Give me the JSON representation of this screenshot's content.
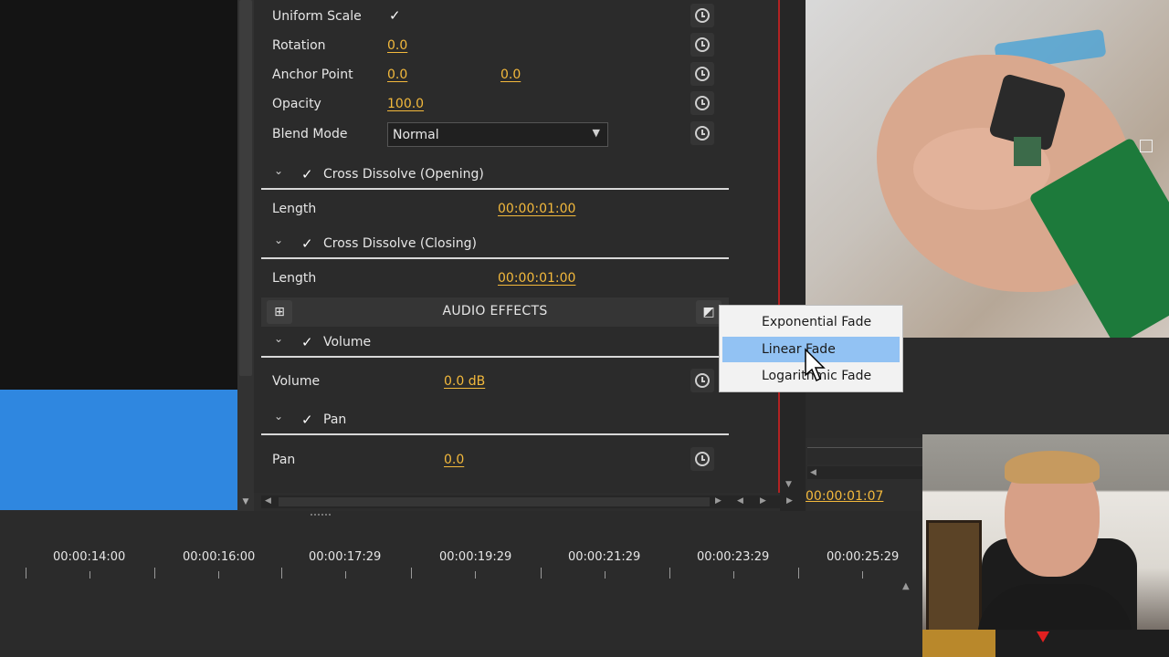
{
  "properties": {
    "uniform_scale": {
      "label": "Uniform Scale",
      "checked": "✓"
    },
    "rotation": {
      "label": "Rotation",
      "value": "0.0"
    },
    "anchor_point": {
      "label": "Anchor Point",
      "x": "0.0",
      "y": "0.0"
    },
    "opacity": {
      "label": "Opacity",
      "value": "100.0"
    },
    "blend_mode": {
      "label": "Blend Mode",
      "value": "Normal"
    }
  },
  "effects": {
    "cross_dissolve_opening": {
      "title": "Cross Dissolve (Opening)",
      "length_label": "Length",
      "length_value": "00:00:01:00"
    },
    "cross_dissolve_closing": {
      "title": "Cross Dissolve (Closing)",
      "length_label": "Length",
      "length_value": "00:00:01:00"
    }
  },
  "audio_effects": {
    "title": "AUDIO EFFECTS",
    "volume": {
      "title": "Volume",
      "label": "Volume",
      "value": "0.0 dB"
    },
    "pan": {
      "title": "Pan",
      "label": "Pan",
      "value": "0.0"
    }
  },
  "fade_menu": {
    "items": [
      "Exponential Fade",
      "Linear Fade",
      "Logarithmic Fade"
    ],
    "selected": "Linear Fade"
  },
  "player": {
    "timecode": "00:00:01:07"
  },
  "timeline": {
    "ruler_labels": [
      "00:00:14:00",
      "00:00:16:00",
      "00:00:17:29",
      "00:00:19:29",
      "00:00:21:29",
      "00:00:23:29",
      "00:00:25:29"
    ]
  },
  "icons": {
    "checkmark": "✓",
    "chevron_down": "⌄",
    "dropdown_arrow": "▼"
  },
  "colors": {
    "accent_value": "#f3b93c",
    "selection": "#92c2f3",
    "playhead": "#b22222",
    "panel_bg": "#2b2b2b"
  }
}
